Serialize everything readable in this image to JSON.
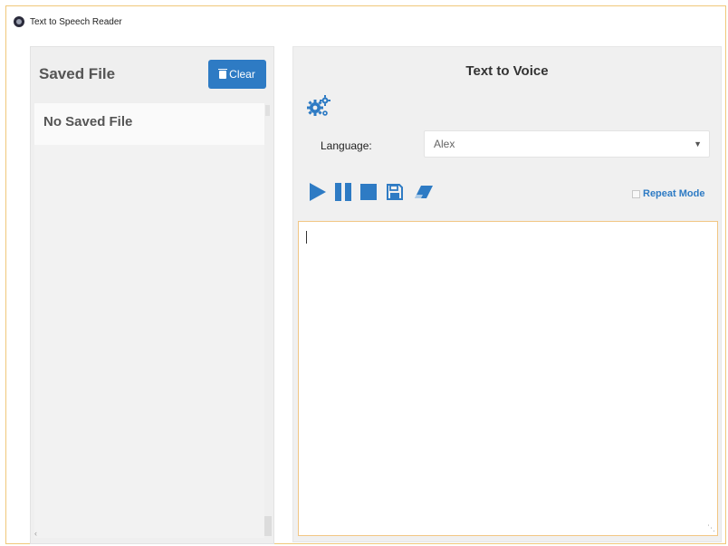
{
  "window": {
    "title": "Text to Speech Reader"
  },
  "saved_panel": {
    "title": "Saved File",
    "clear_label": "Clear",
    "empty_text": "No Saved File"
  },
  "voice_panel": {
    "title": "Text to Voice",
    "language_label": "Language:",
    "language_value": "Alex",
    "repeat_label": "Repeat Mode",
    "text_value": ""
  },
  "icons": {
    "app": "app-icon",
    "settings": "gear-icon",
    "play": "play-icon",
    "pause": "pause-icon",
    "stop": "stop-icon",
    "save": "save-icon",
    "clear_text": "eraser-icon",
    "trash": "trash-icon"
  },
  "colors": {
    "accent": "#2e7bc4",
    "window_border": "#f0c87a",
    "textarea_border": "#f1c684",
    "panel_bg": "#efefef"
  }
}
